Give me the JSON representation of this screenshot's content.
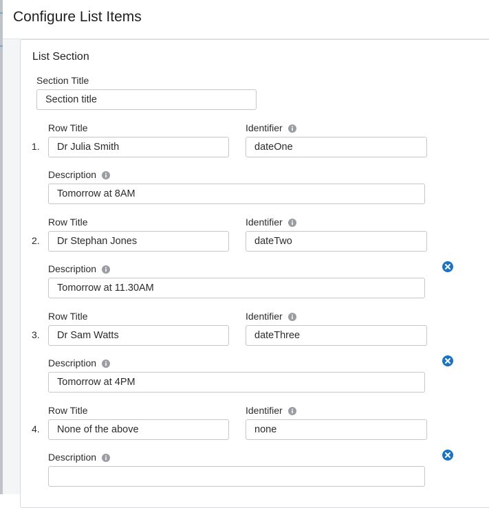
{
  "header": {
    "title": "Configure List Items"
  },
  "section": {
    "heading": "List Section",
    "title_label": "Section Title",
    "title_value": "Section title"
  },
  "labels": {
    "row_title": "Row Title",
    "identifier": "Identifier",
    "description": "Description"
  },
  "rows": [
    {
      "number": "1.",
      "row_title": "Dr Julia Smith",
      "identifier": "dateOne",
      "description": "Tomorrow at 8AM",
      "removable": false
    },
    {
      "number": "2.",
      "row_title": "Dr Stephan Jones",
      "identifier": "dateTwo",
      "description": "Tomorrow at 11.30AM",
      "removable": true
    },
    {
      "number": "3.",
      "row_title": "Dr Sam Watts",
      "identifier": "dateThree",
      "description": "Tomorrow at 4PM",
      "removable": true
    },
    {
      "number": "4.",
      "row_title": "None of the above",
      "identifier": "none",
      "description": "",
      "removable": true
    }
  ],
  "colors": {
    "accent": "#1a73c8",
    "info_icon": "#9a9ea3",
    "border": "#c3c6ca"
  },
  "icons": {
    "info": "info-icon",
    "remove": "close-circle-icon"
  }
}
